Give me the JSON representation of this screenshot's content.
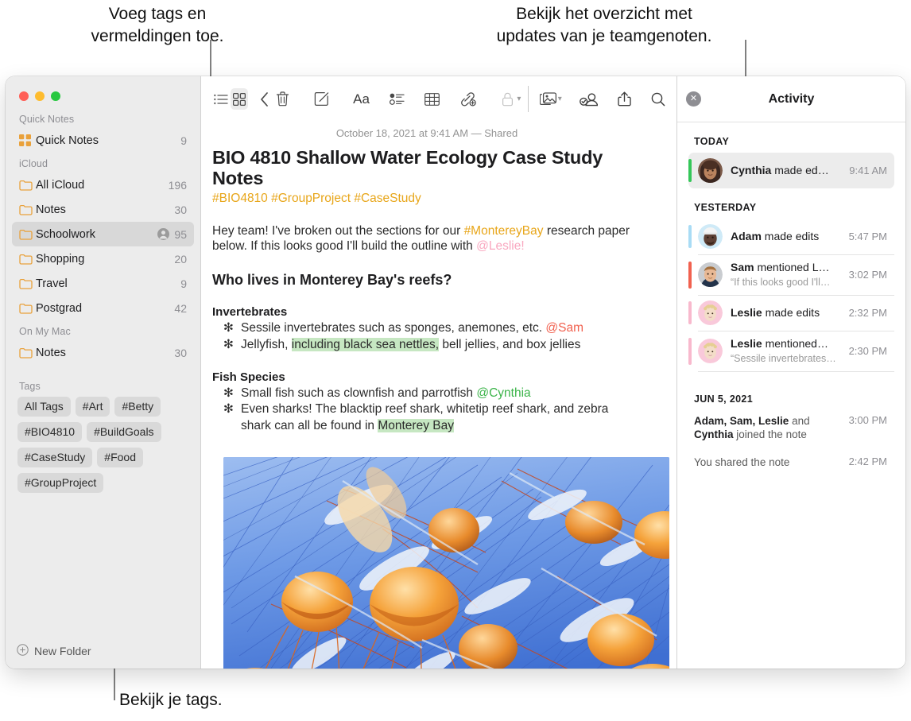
{
  "callouts": {
    "tags": "Voeg tags en\nvermeldingen toe.",
    "activity": "Bekijk het overzicht met\nupdates van je teamgenoten.",
    "view_tags": "Bekijk je tags."
  },
  "sidebar": {
    "sections": [
      {
        "header": "Quick Notes",
        "rows": [
          {
            "icon": "quicknotes-grid-icon",
            "label": "Quick Notes",
            "count": "9",
            "shared": false,
            "selected": false
          }
        ]
      },
      {
        "header": "iCloud",
        "rows": [
          {
            "icon": "folder-icon",
            "label": "All iCloud",
            "count": "196",
            "shared": false,
            "selected": false
          },
          {
            "icon": "folder-icon",
            "label": "Notes",
            "count": "30",
            "shared": false,
            "selected": false
          },
          {
            "icon": "folder-icon",
            "label": "Schoolwork",
            "count": "95",
            "shared": true,
            "selected": true
          },
          {
            "icon": "folder-icon",
            "label": "Shopping",
            "count": "20",
            "shared": false,
            "selected": false
          },
          {
            "icon": "folder-icon",
            "label": "Travel",
            "count": "9",
            "shared": false,
            "selected": false
          },
          {
            "icon": "folder-icon",
            "label": "Postgrad",
            "count": "42",
            "shared": false,
            "selected": false
          }
        ]
      },
      {
        "header": "On My Mac",
        "rows": [
          {
            "icon": "folder-icon",
            "label": "Notes",
            "count": "30",
            "shared": false,
            "selected": false
          }
        ]
      }
    ],
    "tags_header": "Tags",
    "tags": [
      "All Tags",
      "#Art",
      "#Betty",
      "#BIO4810",
      "#BuildGoals",
      "#CaseStudy",
      "#Food",
      "#GroupProject"
    ],
    "new_folder_label": "New Folder"
  },
  "toolbar": {
    "left": [
      {
        "name": "list-view-icon",
        "title": "List view"
      },
      {
        "name": "gallery-view-icon",
        "title": "Gallery view"
      },
      {
        "name": "back-chevron-icon",
        "title": "Back"
      }
    ],
    "right": [
      {
        "name": "trash-icon",
        "title": "Delete"
      },
      {
        "name": "compose-icon",
        "title": "New note"
      },
      {
        "name": "format-aa-icon",
        "title": "Format",
        "text": "Aa"
      },
      {
        "name": "checklist-icon",
        "title": "Checklist"
      },
      {
        "name": "table-icon",
        "title": "Table"
      },
      {
        "name": "link-add-icon",
        "title": "Add link"
      },
      {
        "name": "lock-icon",
        "title": "Lock note"
      },
      {
        "name": "media-icon",
        "title": "Media"
      },
      {
        "name": "share-collaborate-icon",
        "title": "Collaborate"
      },
      {
        "name": "share-icon",
        "title": "Share"
      },
      {
        "name": "search-icon",
        "title": "Search"
      }
    ]
  },
  "note": {
    "date": "October 18, 2021 at 9:41 AM — Shared",
    "title": "BIO 4810 Shallow Water Ecology Case Study Notes",
    "tags": "#BIO4810 #GroupProject #CaseStudy",
    "intro": {
      "p1": "Hey team! I've broken out the sections for our ",
      "mention_tag": "#MontereyBay",
      "p2": " research paper below. If this looks good I'll build the outline with ",
      "mention_person": "@Leslie!"
    },
    "heading": "Who lives in Monterey Bay's reefs?",
    "sections": [
      {
        "title": "Invertebrates",
        "items": [
          {
            "pre": "Sessile invertebrates such as sponges, anemones, etc. ",
            "mention": "@Sam",
            "mention_color": "red",
            "post": ""
          },
          {
            "pre": "Jellyfish, ",
            "highlight": "including black sea nettles,",
            "post": " bell jellies, and box jellies"
          }
        ]
      },
      {
        "title": "Fish Species",
        "items": [
          {
            "pre": "Small fish such as clownfish and parrotfish ",
            "mention": "@Cynthia",
            "mention_color": "green",
            "post": ""
          },
          {
            "pre": "Even sharks! The blacktip reef shark, whitetip reef shark, and zebra shark can all be found in ",
            "highlight": "Monterey Bay",
            "post": ""
          }
        ]
      }
    ],
    "bullet_glyph": "✻",
    "image_alt": "jellyfish-photo"
  },
  "activity": {
    "title": "Activity",
    "close_icon": "close-icon",
    "groups": [
      {
        "header": "TODAY",
        "items": [
          {
            "avatar": "cynthia",
            "bar": "#34c759",
            "name": "Cynthia",
            "action": " made ed…",
            "quote": "",
            "time": "9:41 AM",
            "selected": true
          }
        ]
      },
      {
        "header": "YESTERDAY",
        "items": [
          {
            "avatar": "adam",
            "bar": "#a9dcf5",
            "name": "Adam",
            "action": " made edits",
            "quote": "",
            "time": "5:47 PM",
            "selected": false
          },
          {
            "avatar": "sam",
            "bar": "#f1614f",
            "name": "Sam",
            "action": " mentioned L…",
            "quote": "“If this looks good I'll…",
            "time": "3:02 PM",
            "selected": false
          },
          {
            "avatar": "leslie",
            "bar": "#f8b9cd",
            "name": "Leslie",
            "action": " made edits",
            "quote": "",
            "time": "2:32 PM",
            "selected": false
          },
          {
            "avatar": "leslie",
            "bar": "#f8b9cd",
            "name": "Leslie",
            "action": " mentioned…",
            "quote": "“Sessile invertebrates…",
            "time": "2:30 PM",
            "selected": false
          }
        ]
      }
    ],
    "footer_header": "JUN 5, 2021",
    "footer_items": [
      {
        "bold1": "Adam, Sam, Leslie",
        "mid": " and ",
        "bold2": "Cynthia",
        "tail": " joined the note",
        "time": "3:00 PM"
      },
      {
        "bold1": "",
        "mid": "You shared the note",
        "bold2": "",
        "tail": "",
        "time": "2:42 PM"
      }
    ]
  },
  "colors": {
    "accent_amber": "#e8a61a",
    "highlight_green": "#c6e7c2",
    "mention_red": "#f1614f",
    "mention_green": "#3cb44a",
    "mention_pink": "#f9a7bf",
    "sidebar_bg": "#ececec",
    "folder_icon": "#e9a13b"
  }
}
